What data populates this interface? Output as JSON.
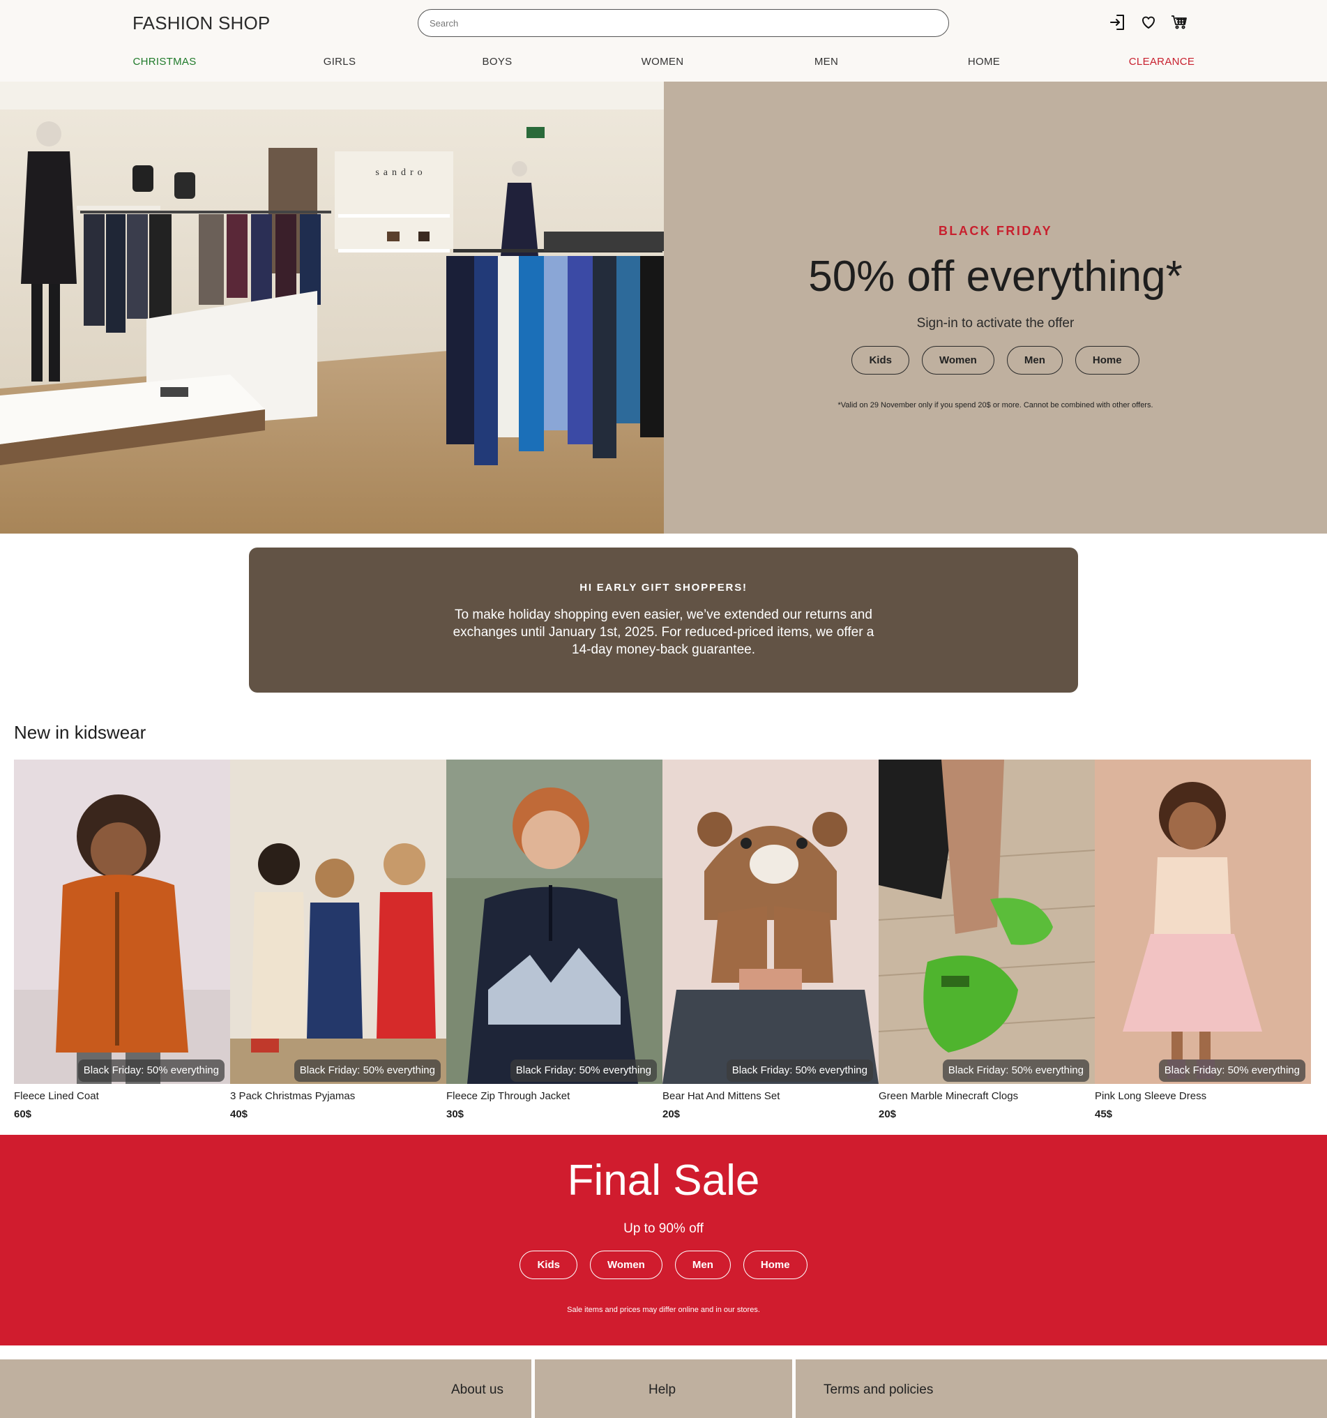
{
  "header": {
    "logo": "FASHION SHOP",
    "search_placeholder": "Search",
    "icons": [
      "sign-in-icon",
      "heart-icon",
      "cart-icon"
    ]
  },
  "nav": [
    {
      "label": "CHRISTMAS",
      "color": "#1f7a2a"
    },
    {
      "label": "GIRLS",
      "color": "#333333"
    },
    {
      "label": "BOYS",
      "color": "#333333"
    },
    {
      "label": "WOMEN",
      "color": "#333333"
    },
    {
      "label": "MEN",
      "color": "#333333"
    },
    {
      "label": "HOME",
      "color": "#333333"
    },
    {
      "label": "CLEARANCE",
      "color": "#c8202e"
    }
  ],
  "hero": {
    "kicker": "BLACK FRIDAY",
    "title": "50% off everything*",
    "subtitle": "Sign-in to activate the offer",
    "buttons": [
      "Kids",
      "Women",
      "Men",
      "Home"
    ],
    "note": "*Valid on 29 November only if you spend 20$ or more. Cannot be combined with other offers.",
    "store_sign": "sandro",
    "colors": {
      "background": "#bfb09f",
      "accent": "#c8202e"
    }
  },
  "gift_banner": {
    "title": "HI EARLY GIFT SHOPPERS!",
    "body": "To make holiday shopping even easier, we’ve extended our returns and exchanges until January 1st, 2025. For reduced-priced items, we offer a 14-day money-back guarantee.",
    "background": "#625345"
  },
  "kidswear": {
    "title": "New in kidswear",
    "badge": "Black Friday: 50% everything",
    "products": [
      {
        "name": "Fleece Lined Coat",
        "price": "60$"
      },
      {
        "name": "3 Pack Christmas Pyjamas",
        "price": "40$"
      },
      {
        "name": "Fleece Zip Through Jacket",
        "price": "30$"
      },
      {
        "name": "Bear Hat And Mittens Set",
        "price": "20$"
      },
      {
        "name": "Green Marble Minecraft Clogs",
        "price": "20$"
      },
      {
        "name": "Pink Long Sleeve Dress",
        "price": "45$"
      }
    ]
  },
  "final_sale": {
    "title": "Final Sale",
    "subtitle": "Up to 90% off",
    "buttons": [
      "Kids",
      "Women",
      "Men",
      "Home"
    ],
    "note": "Sale items and prices may differ online and in our stores.",
    "background": "#d01c2e"
  },
  "footer": {
    "links": [
      "About us",
      "Help",
      "Terms and policies"
    ]
  }
}
